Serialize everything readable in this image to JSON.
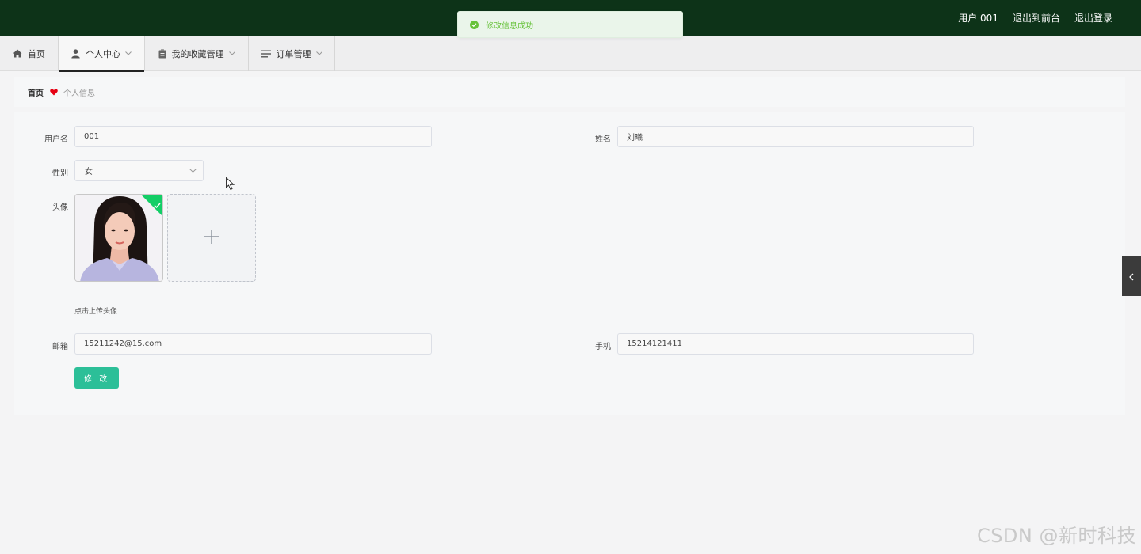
{
  "header": {
    "username": "用户 001",
    "back_to_front": "退出到前台",
    "logout": "退出登录",
    "bg_color": "#0d3318"
  },
  "toast": {
    "message": "修改信息成功",
    "icon": "success-check-icon",
    "color": "#67c23a"
  },
  "nav": {
    "items": [
      {
        "label": "首页",
        "icon": "home-icon",
        "has_dropdown": false
      },
      {
        "label": "个人中心",
        "icon": "user-icon",
        "has_dropdown": true,
        "active": true
      },
      {
        "label": "我的收藏管理",
        "icon": "clipboard-icon",
        "has_dropdown": true
      },
      {
        "label": "订单管理",
        "icon": "list-icon",
        "has_dropdown": true
      }
    ]
  },
  "breadcrumb": {
    "home": "首页",
    "separator_icon": "heart-icon",
    "current": "个人信息"
  },
  "form": {
    "username_label": "用户名",
    "username_value": "001",
    "name_label": "姓名",
    "name_value": "刘曦",
    "gender_label": "性别",
    "gender_value": "女",
    "avatar_label": "头像",
    "upload_tip": "点击上传头像",
    "email_label": "邮箱",
    "email_value": "15211242@15.com",
    "phone_label": "手机",
    "phone_value": "15214121411",
    "submit_label": "修 改",
    "submit_color": "#2cbf98"
  },
  "watermark": "CSDN @新时科技"
}
